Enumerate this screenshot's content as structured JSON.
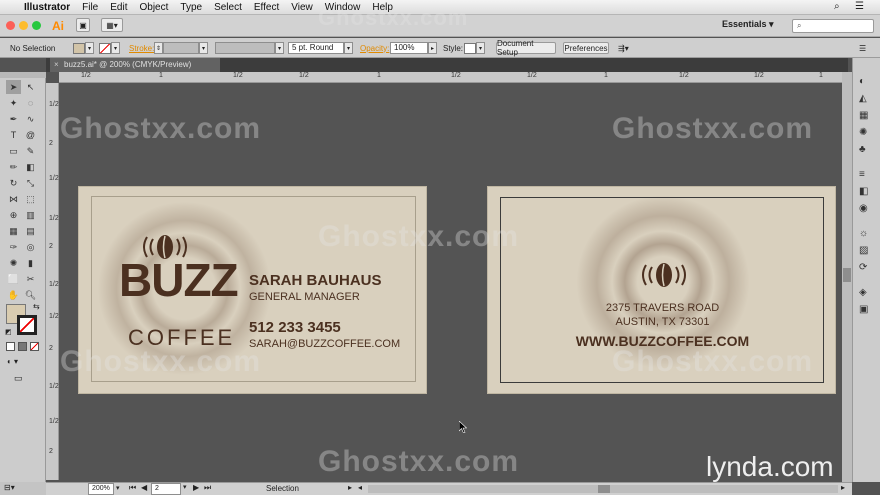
{
  "menubar": {
    "app_name": "Illustrator",
    "items": [
      "File",
      "Edit",
      "Object",
      "Type",
      "Select",
      "Effect",
      "View",
      "Window",
      "Help"
    ]
  },
  "appbar": {
    "logo": "Ai",
    "workspace": "Essentials",
    "workspace_arrow": "▾"
  },
  "controlbar": {
    "selection_label": "No Selection",
    "stroke_label": "Stroke:",
    "brush_value": "5 pt. Round",
    "opacity_label": "Opacity:",
    "opacity_value": "100%",
    "style_label": "Style:",
    "document_setup": "Document Setup",
    "preferences": "Preferences"
  },
  "document_tab": {
    "title": "buzz5.ai* @ 200% (CMYK/Preview)",
    "close": "×"
  },
  "rulers": {
    "top_labels": [
      "1/2",
      "1",
      "1/2",
      "1/2",
      "1",
      "1/2",
      "1/2",
      "1",
      "1/2",
      "1/2",
      "1",
      "1/2",
      "1/2",
      "1",
      "1/2"
    ],
    "left_labels": [
      "1/2",
      "2",
      "1/2",
      "1/2",
      "2",
      "1/2",
      "1/2",
      "2",
      "1/2",
      "1/2",
      "2"
    ]
  },
  "front_card": {
    "logo_buzz": "BUZZ",
    "logo_coffee": "COFFEE",
    "name": "SARAH BAUHAUS",
    "title": "GENERAL MANAGER",
    "phone": "512 233 3455",
    "email": "SARAH@BUZZCOFFEE.COM"
  },
  "back_card": {
    "address1": "2375 TRAVERS ROAD",
    "address2": "AUSTIN, TX 73301",
    "website": "WWW.BUZZCOFFEE.COM"
  },
  "statusbar": {
    "zoom": "200%",
    "artboard": "2",
    "tool": "Selection"
  },
  "watermarks": {
    "main": "Ghostxx.com",
    "brand": "lynda.com"
  },
  "colors": {
    "coffee_brown": "#4b3020",
    "card_beige": "#d9d0be",
    "ai_orange": "#ff8a00"
  }
}
